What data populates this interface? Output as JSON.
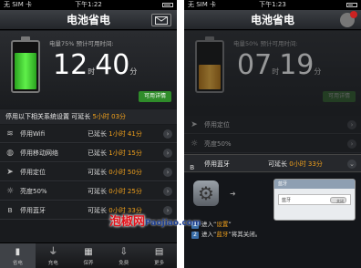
{
  "left": {
    "status": {
      "carrier": "无 SIM 卡",
      "time": "下午1:22"
    },
    "title": "电池省电",
    "battery_percent_text": "电量75% 预计可用时间:",
    "battery_level": 0.75,
    "time_hours": "12",
    "time_minutes": "40",
    "unit_hour": "时",
    "unit_minute": "分",
    "detail_button": "可用详情",
    "settings_header": {
      "prefix": "停用以下相关系统设置 可延长 ",
      "value": "5小时 03分"
    },
    "rows": [
      {
        "icon": "wifi-icon",
        "glyph": "≋",
        "label": "停用Wifi",
        "ext_prefix": "已延长 ",
        "ext_value": "1小时 41分"
      },
      {
        "icon": "globe-icon",
        "glyph": "◍",
        "label": "停用移动网络",
        "ext_prefix": "已延长 ",
        "ext_value": "1小时 15分"
      },
      {
        "icon": "location-icon",
        "glyph": "➤",
        "label": "停用定位",
        "ext_prefix": "可延长 ",
        "ext_value": "0小时 50分"
      },
      {
        "icon": "brightness-icon",
        "glyph": "☼",
        "label": "亮度50%",
        "ext_prefix": "可延长 ",
        "ext_value": "0小时 25分"
      },
      {
        "icon": "bluetooth-icon",
        "glyph": "ʙ",
        "label": "停用蓝牙",
        "ext_prefix": "可延长 ",
        "ext_value": "0小时 33分"
      }
    ],
    "tabs": [
      {
        "icon": "battery-icon",
        "glyph": "▮",
        "label": "省电"
      },
      {
        "icon": "plug-icon",
        "glyph": "⏚",
        "label": "充电"
      },
      {
        "icon": "calendar-icon",
        "glyph": "▦",
        "label": "保养"
      },
      {
        "icon": "download-icon",
        "glyph": "⇩",
        "label": "免费"
      },
      {
        "icon": "grid-icon",
        "glyph": "▤",
        "label": "更多"
      }
    ]
  },
  "right": {
    "status": {
      "carrier": "无 SIM 卡",
      "time": "下午1:23"
    },
    "title": "电池省电",
    "battery_percent_text": "电量50% 预计可用时间:",
    "battery_level": 0.5,
    "time_hours": "07",
    "time_minutes": "19",
    "unit_hour": "时",
    "unit_minute": "分",
    "detail_button": "可用详情",
    "rows": [
      {
        "icon": "location-icon",
        "glyph": "➤",
        "label": "停用定位",
        "ext_prefix": "",
        "ext_value": ""
      },
      {
        "icon": "brightness-icon",
        "glyph": "☼",
        "label": "亮度50%",
        "ext_prefix": "",
        "ext_value": ""
      }
    ],
    "highlight": {
      "icon": "bluetooth-icon",
      "glyph": "ʙ",
      "label": "停用蓝牙",
      "ext_prefix": "可延长 ",
      "ext_value": "0小时 33分"
    },
    "dialog": {
      "title": "蓝牙",
      "row_label": "蓝牙",
      "toggle": "关闭"
    },
    "steps": [
      {
        "num": "1",
        "prefix": "进入“",
        "hl": "设置",
        "suffix": "”"
      },
      {
        "num": "2",
        "prefix": "进入“",
        "hl": "蓝牙",
        "suffix": "”将其关闭。"
      }
    ]
  },
  "watermark": {
    "text": "泡椒网",
    "domain": "Paojiao.com"
  },
  "colors": {
    "accent": "#f3a21c",
    "green": "#2f8c2a",
    "battery_green": "#3fd42c",
    "battery_orange": "#e09a1c",
    "watermark": "#e2131b"
  }
}
